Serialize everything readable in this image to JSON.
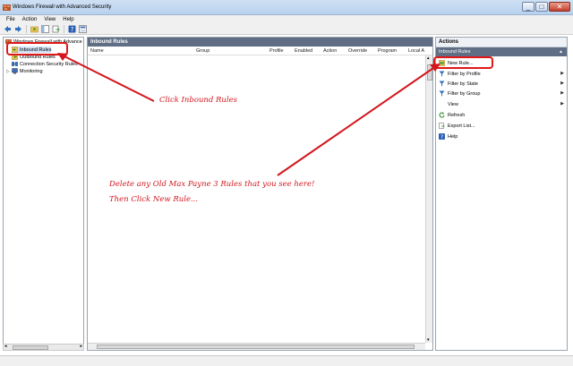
{
  "window": {
    "title": "Windows Firewall with Advanced Security"
  },
  "window_controls": {
    "minimize": "_",
    "maximize": "□",
    "close": "✕"
  },
  "menu": [
    "File",
    "Action",
    "View",
    "Help"
  ],
  "tree": {
    "root": "Windows Firewall with Advance",
    "items": [
      "Inbound Rules",
      "Outbound Rules",
      "Connection Security Rules",
      "Monitoring"
    ]
  },
  "center": {
    "header": "Inbound Rules",
    "columns": [
      "Name",
      "Group",
      "Profile",
      "Enabled",
      "Action",
      "Override",
      "Program",
      "Local A"
    ]
  },
  "actions": {
    "title": "Actions",
    "section": "Inbound Rules",
    "items": [
      "New Rule...",
      "Filter by Profile",
      "Filter by State",
      "Filter by Group",
      "View",
      "Refresh",
      "Export List...",
      "Help"
    ]
  },
  "annotations": {
    "click_inbound": "Click Inbound Rules",
    "delete_line1": "Delete any Old Max Payne 3 Rules that you see here!",
    "delete_line2": "Then Click New Rule..."
  },
  "colors": {
    "annotation": "#d2161d",
    "pane_header": "#5f6e84"
  }
}
